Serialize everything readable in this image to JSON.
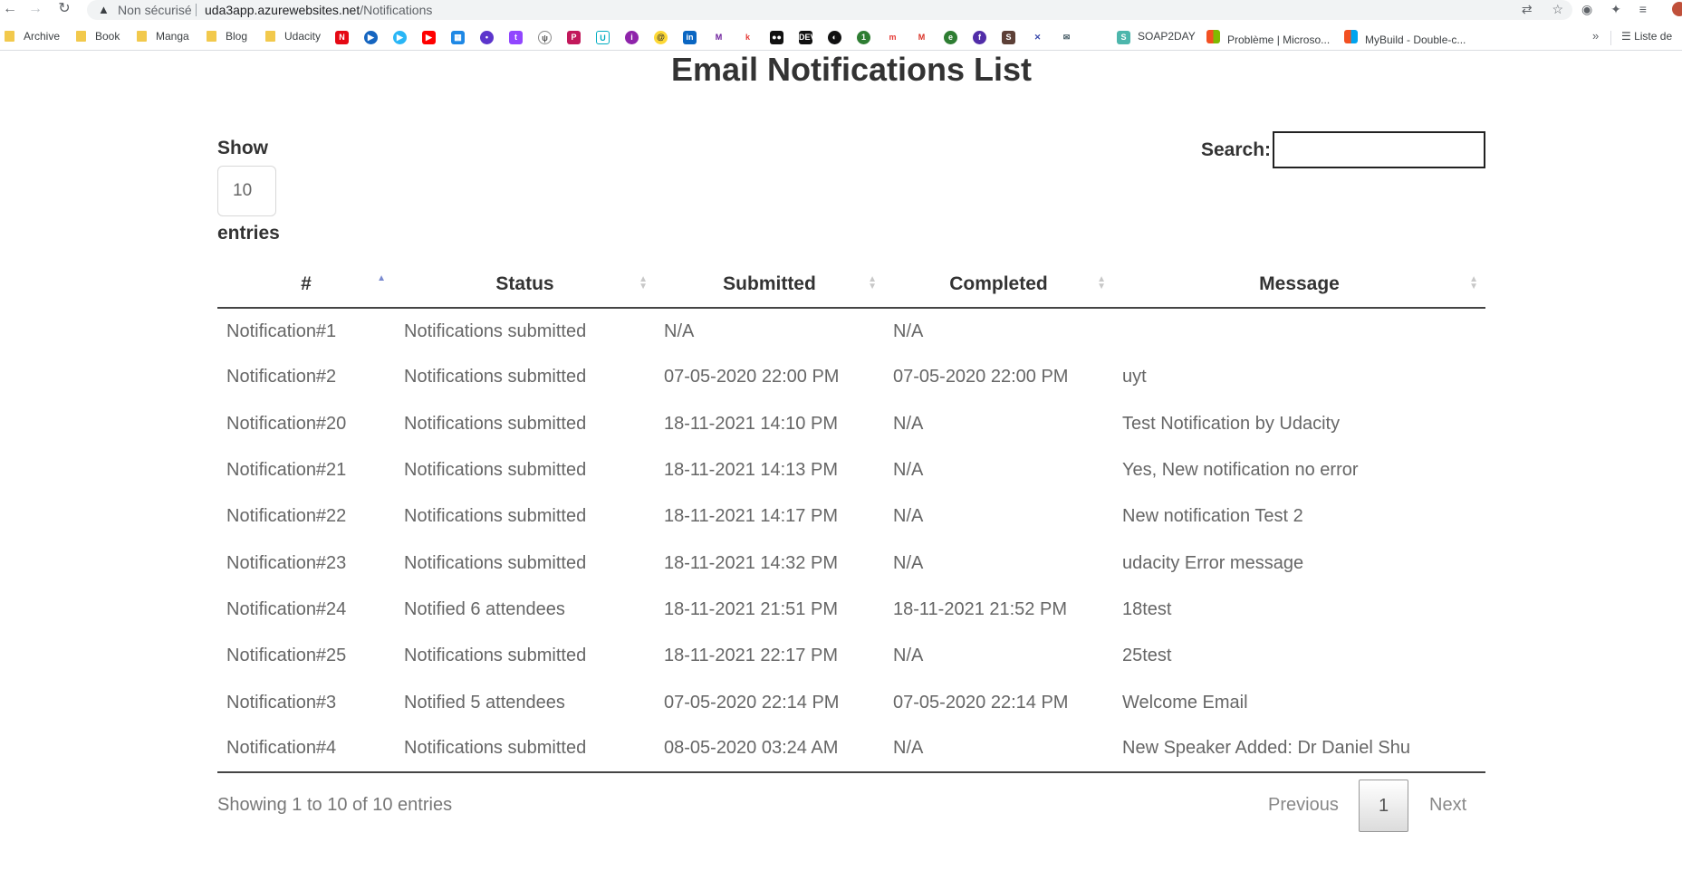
{
  "browser": {
    "insecure_label": "Non sécurisé",
    "url_host": "uda3app.azurewebsites.net",
    "url_path": "/Notifications",
    "bookmarks": [
      "Archive",
      "Book",
      "Manga",
      "Blog",
      "Udacity"
    ],
    "bookmarks_right": [
      "SOAP2DAY",
      "Problème | Microso...",
      "MyBuild - Double-c..."
    ],
    "reading_list": "Liste de",
    "more": "»"
  },
  "page": {
    "title": "Email Notifications List",
    "show_label": "Show",
    "entries_value": "10",
    "entries_label": "entries",
    "search_label": "Search:",
    "search_value": ""
  },
  "table": {
    "headers": [
      "#",
      "Status",
      "Submitted",
      "Completed",
      "Message"
    ],
    "rows": [
      [
        "Notification#1",
        "Notifications submitted",
        "N/A",
        "N/A",
        ""
      ],
      [
        "Notification#2",
        "Notifications submitted",
        "07-05-2020 22:00 PM",
        "07-05-2020 22:00 PM",
        "uyt"
      ],
      [
        "Notification#20",
        "Notifications submitted",
        "18-11-2021 14:10 PM",
        "N/A",
        "Test Notification by Udacity"
      ],
      [
        "Notification#21",
        "Notifications submitted",
        "18-11-2021 14:13 PM",
        "N/A",
        "Yes, New notification no error"
      ],
      [
        "Notification#22",
        "Notifications submitted",
        "18-11-2021 14:17 PM",
        "N/A",
        "New notification Test 2"
      ],
      [
        "Notification#23",
        "Notifications submitted",
        "18-11-2021 14:32 PM",
        "N/A",
        "udacity Error message"
      ],
      [
        "Notification#24",
        "Notified 6 attendees",
        "18-11-2021 21:51 PM",
        "18-11-2021 21:52 PM",
        "18test"
      ],
      [
        "Notification#25",
        "Notifications submitted",
        "18-11-2021 22:17 PM",
        "N/A",
        "25test"
      ],
      [
        "Notification#3",
        "Notified 5 attendees",
        "07-05-2020 22:14 PM",
        "07-05-2020 22:14 PM",
        "Welcome Email"
      ],
      [
        "Notification#4",
        "Notifications submitted",
        "08-05-2020 03:24 AM",
        "N/A",
        "New Speaker Added: Dr Daniel Shu"
      ]
    ]
  },
  "footer": {
    "info": "Showing 1 to 10 of 10 entries",
    "previous": "Previous",
    "page": "1",
    "next": "Next"
  }
}
